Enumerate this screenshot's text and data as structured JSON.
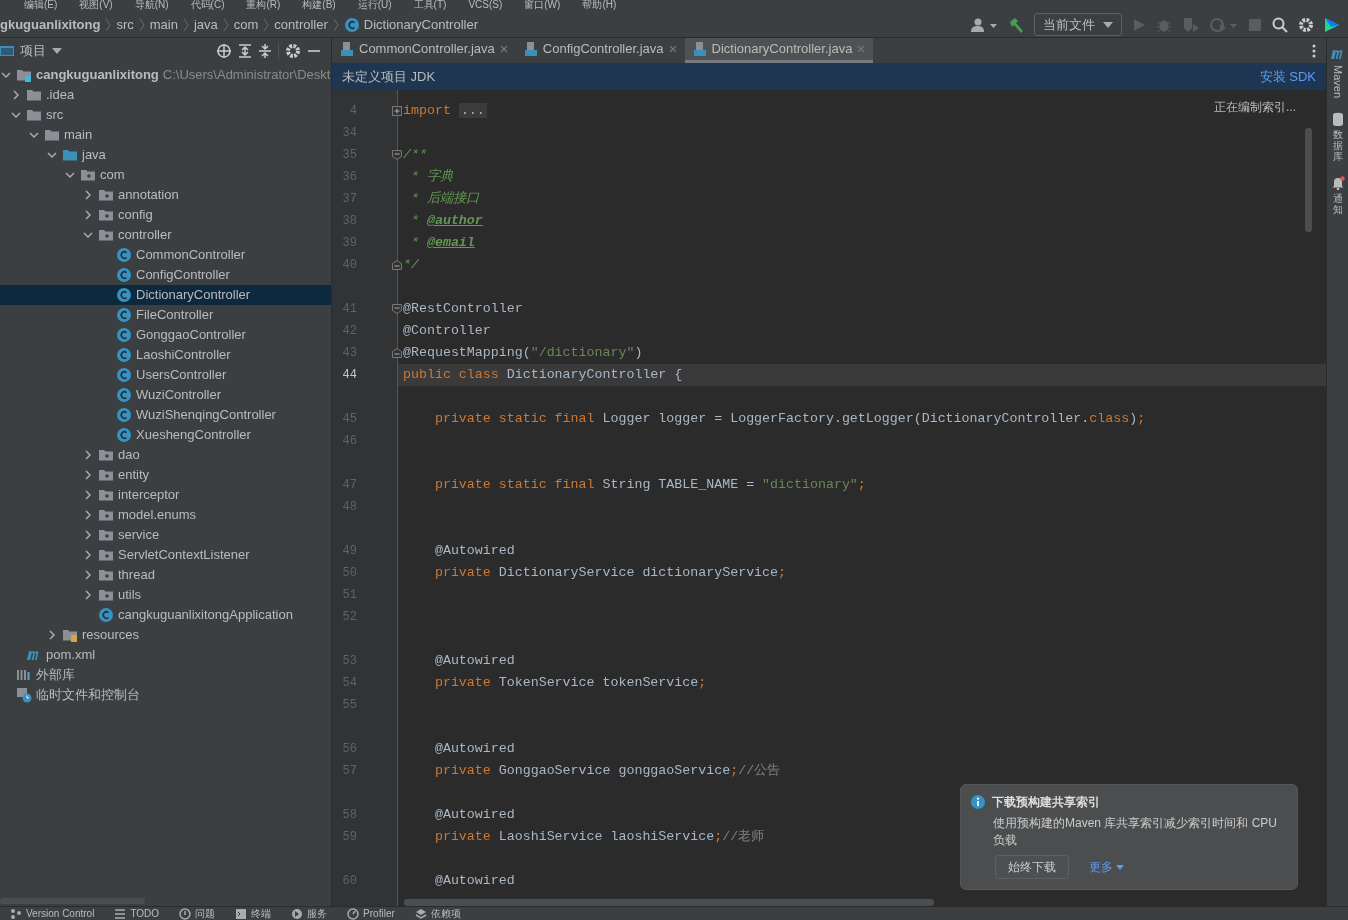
{
  "menu": [
    "编辑(E)",
    "视图(V)",
    "导航(N)",
    "代码(C)",
    "重构(R)",
    "构建(B)",
    "运行(U)",
    "工具(T)",
    "VCS(S)",
    "窗口(W)",
    "帮助(H)"
  ],
  "breadcrumbs": [
    {
      "label": "gkuguanlixitong",
      "kind": "project"
    },
    {
      "label": "src",
      "kind": "folder"
    },
    {
      "label": "main",
      "kind": "folder"
    },
    {
      "label": "java",
      "kind": "folder"
    },
    {
      "label": "com",
      "kind": "folder"
    },
    {
      "label": "controller",
      "kind": "folder"
    },
    {
      "label": "DictionaryController",
      "kind": "class"
    }
  ],
  "run_config": "当前文件",
  "project_panel": {
    "title": "项目"
  },
  "tree": [
    {
      "label": "cangkuguanlixitong",
      "path": "C:\\Users\\Administrator\\Deskt",
      "kind": "module",
      "expanded": true,
      "selected": false,
      "children": [
        {
          "label": ".idea",
          "kind": "folder",
          "expanded": false,
          "selected": false
        },
        {
          "label": "src",
          "kind": "folder",
          "expanded": true,
          "selected": false,
          "children": [
            {
              "label": "main",
              "kind": "folder",
              "expanded": true,
              "selected": false,
              "children": [
                {
                  "label": "java",
                  "kind": "source",
                  "expanded": true,
                  "selected": false,
                  "children": [
                    {
                      "label": "com",
                      "kind": "package",
                      "expanded": true,
                      "selected": false,
                      "children": [
                        {
                          "label": "annotation",
                          "kind": "package",
                          "expanded": false,
                          "selected": false
                        },
                        {
                          "label": "config",
                          "kind": "package",
                          "expanded": false,
                          "selected": false
                        },
                        {
                          "label": "controller",
                          "kind": "package",
                          "expanded": true,
                          "selected": false,
                          "children": [
                            {
                              "label": "CommonController",
                              "kind": "class",
                              "selected": false
                            },
                            {
                              "label": "ConfigController",
                              "kind": "class",
                              "selected": false
                            },
                            {
                              "label": "DictionaryController",
                              "kind": "class",
                              "selected": true
                            },
                            {
                              "label": "FileController",
                              "kind": "class",
                              "selected": false
                            },
                            {
                              "label": "GonggaoController",
                              "kind": "class",
                              "selected": false
                            },
                            {
                              "label": "LaoshiController",
                              "kind": "class",
                              "selected": false
                            },
                            {
                              "label": "UsersController",
                              "kind": "class",
                              "selected": false
                            },
                            {
                              "label": "WuziController",
                              "kind": "class",
                              "selected": false
                            },
                            {
                              "label": "WuziShenqingController",
                              "kind": "class",
                              "selected": false
                            },
                            {
                              "label": "XueshengController",
                              "kind": "class",
                              "selected": false
                            }
                          ]
                        },
                        {
                          "label": "dao",
                          "kind": "package",
                          "expanded": false,
                          "selected": false
                        },
                        {
                          "label": "entity",
                          "kind": "package",
                          "expanded": false,
                          "selected": false
                        },
                        {
                          "label": "interceptor",
                          "kind": "package",
                          "expanded": false,
                          "selected": false
                        },
                        {
                          "label": "model.enums",
                          "kind": "package",
                          "expanded": false,
                          "selected": false
                        },
                        {
                          "label": "service",
                          "kind": "package",
                          "expanded": false,
                          "selected": false
                        },
                        {
                          "label": "ServletContextListener",
                          "kind": "package",
                          "expanded": false,
                          "selected": false
                        },
                        {
                          "label": "thread",
                          "kind": "package",
                          "expanded": false,
                          "selected": false
                        },
                        {
                          "label": "utils",
                          "kind": "package",
                          "expanded": false,
                          "selected": false
                        },
                        {
                          "label": "cangkuguanlixitongApplication",
                          "kind": "class",
                          "selected": false
                        }
                      ]
                    }
                  ]
                },
                {
                  "label": "resources",
                  "kind": "resources",
                  "expanded": false,
                  "selected": false
                }
              ]
            }
          ]
        },
        {
          "label": "pom.xml",
          "kind": "maven",
          "selected": false
        }
      ]
    },
    {
      "label": "外部库",
      "kind": "library",
      "selected": false
    },
    {
      "label": "临时文件和控制台",
      "kind": "scratch",
      "selected": false
    }
  ],
  "tabs": [
    {
      "label": "CommonController.java",
      "selected": false
    },
    {
      "label": "ConfigController.java",
      "selected": false
    },
    {
      "label": "DictionaryController.java",
      "selected": true
    }
  ],
  "jdk_banner": {
    "message": "未定义项目 JDK",
    "action": "安装 SDK"
  },
  "indexing": "正在编制索引...",
  "code": [
    {
      "kind": "code",
      "number": "4",
      "fold_marker": {
        "start": true,
        "collapsed": true
      },
      "tokens": [
        {
          "kind": "kw",
          "s": "import"
        },
        {
          "kind": "folded",
          "s": "..."
        }
      ]
    },
    {
      "kind": "code",
      "number": "34"
    },
    {
      "kind": "code",
      "number": "35",
      "fold_marker": {
        "start": true,
        "collapsed": false
      },
      "tokens": [
        {
          "kind": "doc",
          "s": "/**"
        }
      ]
    },
    {
      "kind": "code",
      "number": "36",
      "tokens": [
        {
          "kind": "doc",
          "s": " * 字典"
        }
      ]
    },
    {
      "kind": "code",
      "number": "37",
      "tokens": [
        {
          "kind": "doc",
          "s": " * 后端接口"
        }
      ]
    },
    {
      "kind": "code",
      "number": "38",
      "tokens": [
        {
          "kind": "doc",
          "s": " * "
        },
        {
          "kind": "doctag",
          "s": "@author"
        }
      ]
    },
    {
      "kind": "code",
      "number": "39",
      "tokens": [
        {
          "kind": "doc",
          "s": " * "
        },
        {
          "kind": "doctag",
          "s": "@email"
        }
      ]
    },
    {
      "kind": "code",
      "number": "40",
      "fold_marker": {
        "start": false
      },
      "tokens": [
        {
          "kind": "doc",
          "s": "*/"
        }
      ]
    },
    {
      "kind": "spacer"
    },
    {
      "kind": "code",
      "number": "41",
      "fold_marker": {
        "start": true,
        "collapsed": false
      },
      "tokens": [
        {
          "kind": "plain",
          "s": "@RestController"
        }
      ]
    },
    {
      "kind": "code",
      "number": "42",
      "tokens": [
        {
          "kind": "plain",
          "s": "@Controller"
        }
      ]
    },
    {
      "kind": "code",
      "number": "43",
      "fold_marker": {
        "start": false
      },
      "tokens": [
        {
          "kind": "plain",
          "s": "@RequestMapping("
        },
        {
          "kind": "str",
          "s": "\"/dictionary\""
        },
        {
          "kind": "plain",
          "s": ")"
        }
      ]
    },
    {
      "kind": "code",
      "number": "44",
      "current": true,
      "tokens": [
        {
          "kind": "kw",
          "s": "public class "
        },
        {
          "kind": "plain",
          "s": "DictionaryController {"
        }
      ]
    },
    {
      "kind": "spacer"
    },
    {
      "kind": "code",
      "number": "45",
      "tokens": [
        {
          "kind": "kw",
          "s": "    private static final "
        },
        {
          "kind": "plain",
          "s": "Logger logger = LoggerFactory.getLogger(DictionaryController."
        },
        {
          "kind": "kw",
          "s": "class"
        },
        {
          "kind": "plain",
          "s": ")"
        },
        {
          "kind": "kw",
          "s": ";"
        }
      ]
    },
    {
      "kind": "code",
      "number": "46"
    },
    {
      "kind": "spacer"
    },
    {
      "kind": "code",
      "number": "47",
      "tokens": [
        {
          "kind": "kw",
          "s": "    private static final "
        },
        {
          "kind": "plain",
          "s": "String TABLE_NAME = "
        },
        {
          "kind": "str",
          "s": "\"dictionary\""
        },
        {
          "kind": "kw",
          "s": ";"
        }
      ]
    },
    {
      "kind": "code",
      "number": "48"
    },
    {
      "kind": "spacer"
    },
    {
      "kind": "code",
      "number": "49",
      "tokens": [
        {
          "kind": "plain",
          "s": "    @Autowired"
        }
      ]
    },
    {
      "kind": "code",
      "number": "50",
      "tokens": [
        {
          "kind": "kw",
          "s": "    private "
        },
        {
          "kind": "plain",
          "s": "DictionaryService dictionaryService"
        },
        {
          "kind": "kw",
          "s": ";"
        }
      ]
    },
    {
      "kind": "code",
      "number": "51"
    },
    {
      "kind": "code",
      "number": "52"
    },
    {
      "kind": "spacer"
    },
    {
      "kind": "code",
      "number": "53",
      "tokens": [
        {
          "kind": "plain",
          "s": "    @Autowired"
        }
      ]
    },
    {
      "kind": "code",
      "number": "54",
      "tokens": [
        {
          "kind": "kw",
          "s": "    private "
        },
        {
          "kind": "plain",
          "s": "TokenService tokenService"
        },
        {
          "kind": "kw",
          "s": ";"
        }
      ]
    },
    {
      "kind": "code",
      "number": "55"
    },
    {
      "kind": "spacer"
    },
    {
      "kind": "code",
      "number": "56",
      "tokens": [
        {
          "kind": "plain",
          "s": "    @Autowired"
        }
      ]
    },
    {
      "kind": "code",
      "number": "57",
      "tokens": [
        {
          "kind": "kw",
          "s": "    private "
        },
        {
          "kind": "plain",
          "s": "GonggaoService gonggaoService"
        },
        {
          "kind": "kw",
          "s": ";"
        },
        {
          "kind": "comment",
          "s": "//公告"
        }
      ]
    },
    {
      "kind": "spacer"
    },
    {
      "kind": "code",
      "number": "58",
      "tokens": [
        {
          "kind": "plain",
          "s": "    @Autowired"
        }
      ]
    },
    {
      "kind": "code",
      "number": "59",
      "tokens": [
        {
          "kind": "kw",
          "s": "    private "
        },
        {
          "kind": "plain",
          "s": "LaoshiService laoshiService"
        },
        {
          "kind": "kw",
          "s": ";"
        },
        {
          "kind": "comment",
          "s": "//老师"
        }
      ]
    },
    {
      "kind": "spacer"
    },
    {
      "kind": "code",
      "number": "60",
      "tokens": [
        {
          "kind": "plain",
          "s": "    @Autowired"
        }
      ]
    }
  ],
  "side_tools": [
    {
      "label": "Maven",
      "kind": "maven"
    },
    {
      "label": "数据库",
      "kind": "database"
    },
    {
      "label": "通知",
      "kind": "bell"
    }
  ],
  "notification": {
    "title": "下载预构建共享索引",
    "body": "使用预构建的Maven 库共享索引减少索引时间和 CPU 负载",
    "button": "始终下载",
    "more": "更多"
  },
  "bottom_tools": [
    {
      "label": "Version Control",
      "kind": "vcs"
    },
    {
      "label": "TODO",
      "kind": "todo"
    },
    {
      "label": "问题",
      "kind": "problems"
    },
    {
      "label": "终端",
      "kind": "terminal"
    },
    {
      "label": "服务",
      "kind": "services"
    },
    {
      "label": "Profiler",
      "kind": "profiler"
    },
    {
      "label": "依赖项",
      "kind": "deps"
    }
  ]
}
